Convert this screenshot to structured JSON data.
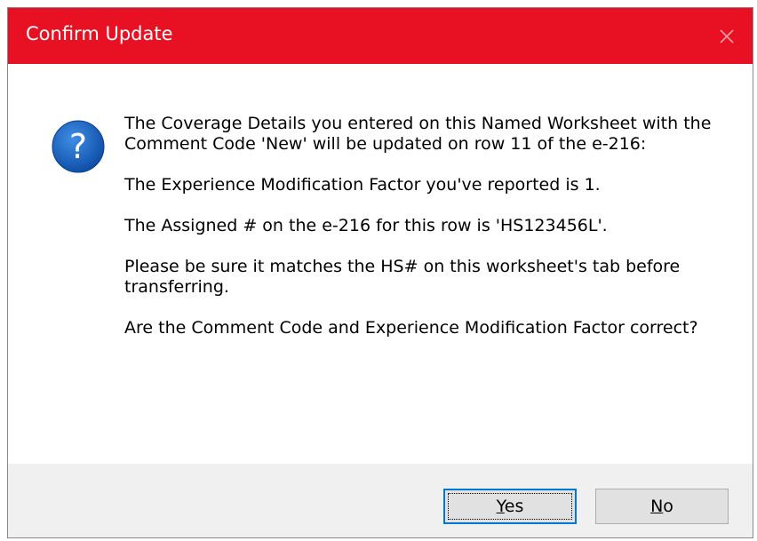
{
  "window": {
    "title": "Confirm Update",
    "close_glyph": "×",
    "icon": "question-icon",
    "colors": {
      "titlebar": "#e81123",
      "icon": "#1a64c0",
      "focus": "#0078d7"
    }
  },
  "message": {
    "paragraphs": [
      "The Coverage Details you entered on this Named Worksheet with the Comment Code 'New' will be updated on row 11 of the e-216:",
      "The Experience Modification Factor you've reported is 1.",
      "The Assigned # on the e-216 for this row is 'HS123456L'.",
      "Please be sure it matches the HS# on this worksheet's tab before transferring.",
      "Are the Comment Code and Experience Modification Factor correct?"
    ]
  },
  "buttons": {
    "yes": {
      "mnemonic": "Y",
      "rest": "es"
    },
    "no": {
      "mnemonic": "N",
      "rest": "o"
    }
  }
}
